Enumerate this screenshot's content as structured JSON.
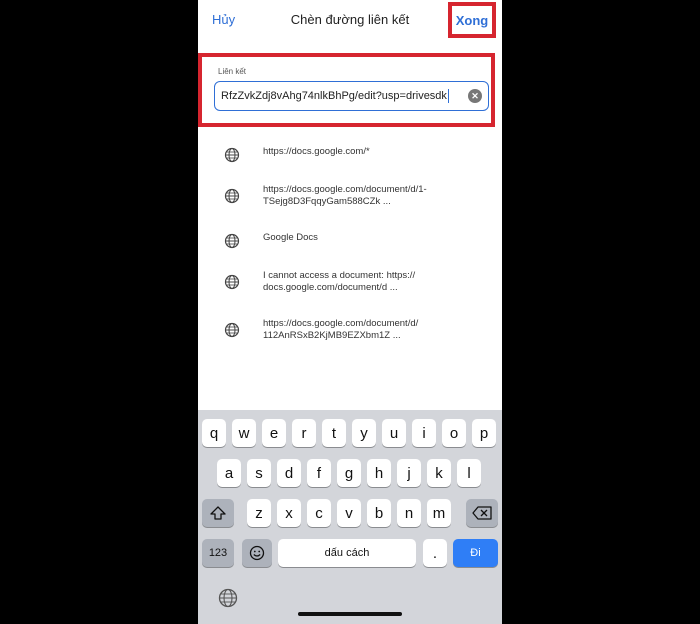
{
  "nav": {
    "cancel_label": "Hủy",
    "title": "Chèn đường liên kết",
    "done_label": "Xong"
  },
  "link_field": {
    "label": "Liên kết",
    "value": "RfzZvkZdj8vAhg74nlkBhPg/edit?usp=drivesdk"
  },
  "suggestions": [
    {
      "icon": "globe-icon",
      "line1": "https://docs.google.com/*",
      "line2": ""
    },
    {
      "icon": "globe-icon",
      "line1": "https://docs.google.com/document/d/1-",
      "line2": "TSejg8D3FqqyGam588CZk ..."
    },
    {
      "icon": "globe-icon",
      "line1": "Google Docs",
      "line2": ""
    },
    {
      "icon": "globe-icon",
      "line1": "I cannot access a document: https://",
      "line2": "docs.google.com/document/d ..."
    },
    {
      "icon": "globe-icon",
      "line1": "https://docs.google.com/document/d/",
      "line2": "112AnRSxB2KjMB9EZXbm1Z ..."
    }
  ],
  "keyboard": {
    "row1": [
      "q",
      "w",
      "e",
      "r",
      "t",
      "y",
      "u",
      "i",
      "o",
      "p"
    ],
    "row2": [
      "a",
      "s",
      "d",
      "f",
      "g",
      "h",
      "j",
      "k",
      "l"
    ],
    "row3": [
      "z",
      "x",
      "c",
      "v",
      "b",
      "n",
      "m"
    ],
    "numbers_label": "123",
    "space_label": "dấu cách",
    "period_label": ".",
    "go_label": "Đi"
  },
  "colors": {
    "accent": "#2f6fd6",
    "highlight_border": "#d6252f",
    "keyboard_bg": "#d3d5da"
  }
}
